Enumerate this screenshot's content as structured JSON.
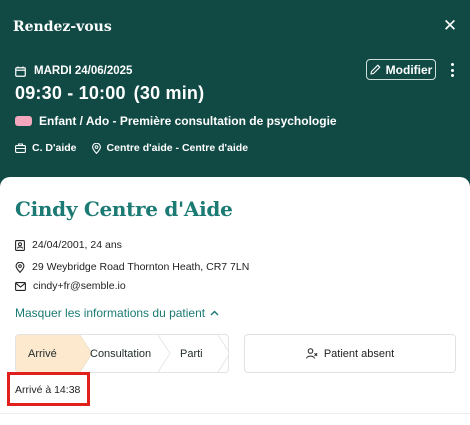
{
  "header": {
    "title": "Rendez-vous",
    "date": "MARDI 24/06/2025",
    "time_range": "09:30 - 10:00",
    "duration": "(30 min)",
    "modify_label": "Modifier",
    "appointment_type": "Enfant / Ado - Première consultation de psychologie",
    "type_color": "#f3a7bf",
    "practitioner": "C. D'aide",
    "location": "Centre d'aide - Centre d'aide"
  },
  "patient": {
    "name": "Cindy Centre d'Aide",
    "dob": "24/04/2001, 24 ans",
    "address": "29 Weybridge Road Thornton Heath, CR7 7LN",
    "email": "cindy+fr@semble.io",
    "toggle_label": "Masquer les informations du patient"
  },
  "status": {
    "steps": [
      "Arrivé",
      "Consultation",
      "Parti"
    ],
    "active_step": "Arrivé",
    "absent_label": "Patient absent",
    "arrived_at": "Arrivé à 14:38"
  },
  "colors": {
    "header_bg": "#114a45",
    "accent": "#1b7a73",
    "active_step_bg": "#fde9cd",
    "highlight": "#e0201a"
  }
}
